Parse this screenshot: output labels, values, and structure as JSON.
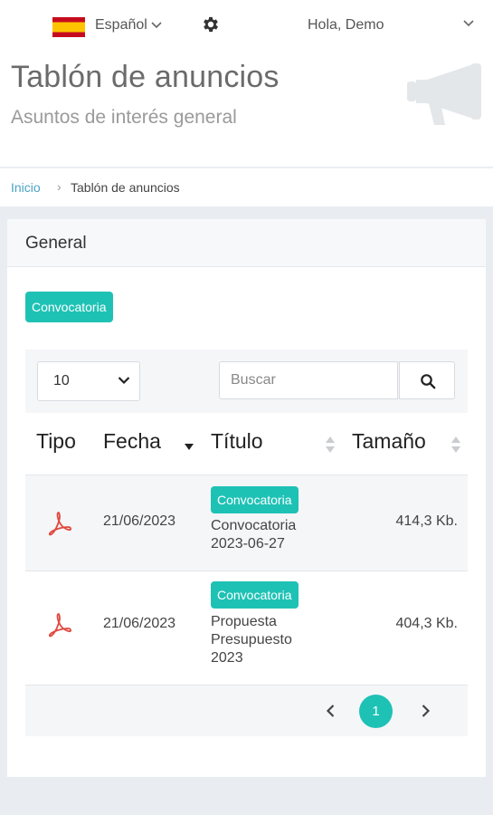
{
  "topbar": {
    "language": "Español",
    "greeting_prefix": "Hola, ",
    "user_name": "Demo"
  },
  "header": {
    "title": "Tablón de anuncios",
    "subtitle": "Asuntos de interés general"
  },
  "breadcrumb": {
    "home": "Inicio",
    "separator": "›",
    "current": "Tablón de anuncios"
  },
  "panel": {
    "title": "General",
    "filter_badge": "Convocatoria"
  },
  "toolbar": {
    "page_size": "10",
    "search_placeholder": "Buscar"
  },
  "table": {
    "columns": [
      "Tipo",
      "Fecha",
      "Título",
      "Tamaño"
    ],
    "rows": [
      {
        "type_icon": "pdf-icon",
        "date": "21/06/2023",
        "badge": "Convocatoria",
        "title_lines": [
          "Convocatoria",
          "2023-06-27"
        ],
        "size": "414,3 Kb."
      },
      {
        "type_icon": "pdf-icon",
        "date": "21/06/2023",
        "badge": "Convocatoria",
        "title_lines": [
          "Propuesta",
          "Presupuesto",
          "2023"
        ],
        "size": "404,3 Kb."
      }
    ]
  },
  "pagination": {
    "current_page": "1"
  },
  "colors": {
    "accent": "#1ec2b5",
    "link": "#4aa3c5",
    "pdf": "#e0483f"
  }
}
